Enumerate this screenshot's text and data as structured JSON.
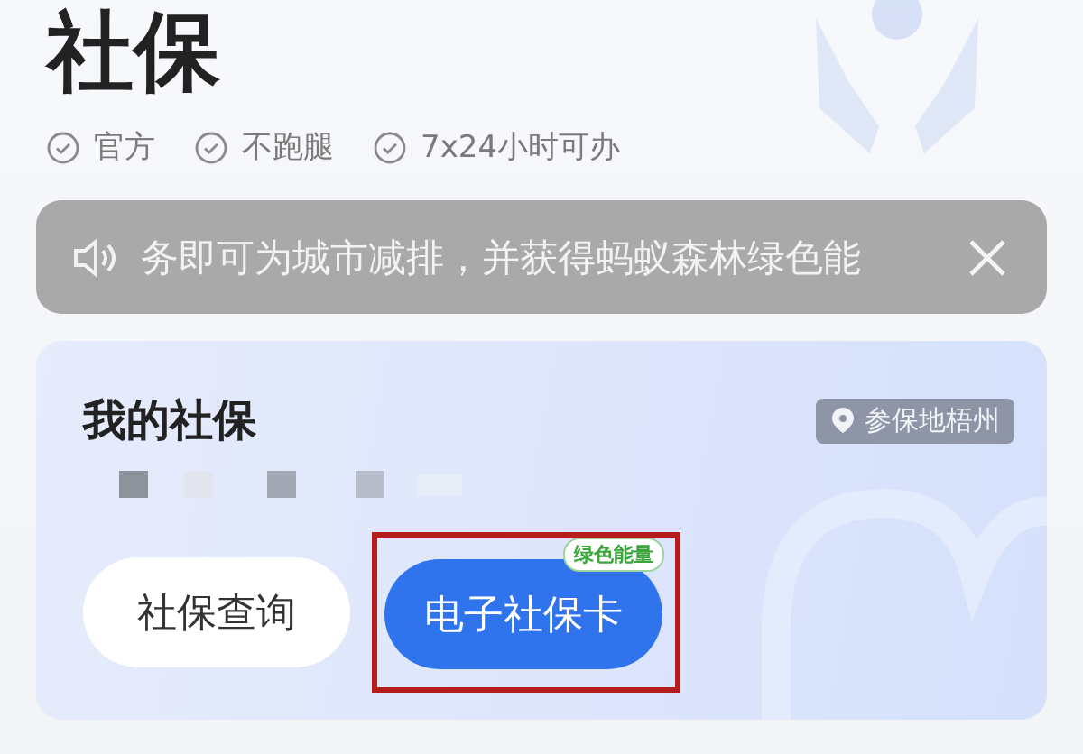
{
  "title": "社保",
  "tags": [
    "官方",
    "不跑腿",
    "7x24小时可办"
  ],
  "notice": {
    "text": "务即可为城市减排，并获得蚂蚁森林绿色能"
  },
  "card": {
    "title": "我的社保",
    "location": "参保地梧州",
    "buttons": [
      {
        "label": "社保查询",
        "kind": "plain",
        "highlighted": false
      },
      {
        "label": "电子社保卡",
        "kind": "primary",
        "badge": "绿色能量",
        "highlighted": true
      }
    ]
  }
}
